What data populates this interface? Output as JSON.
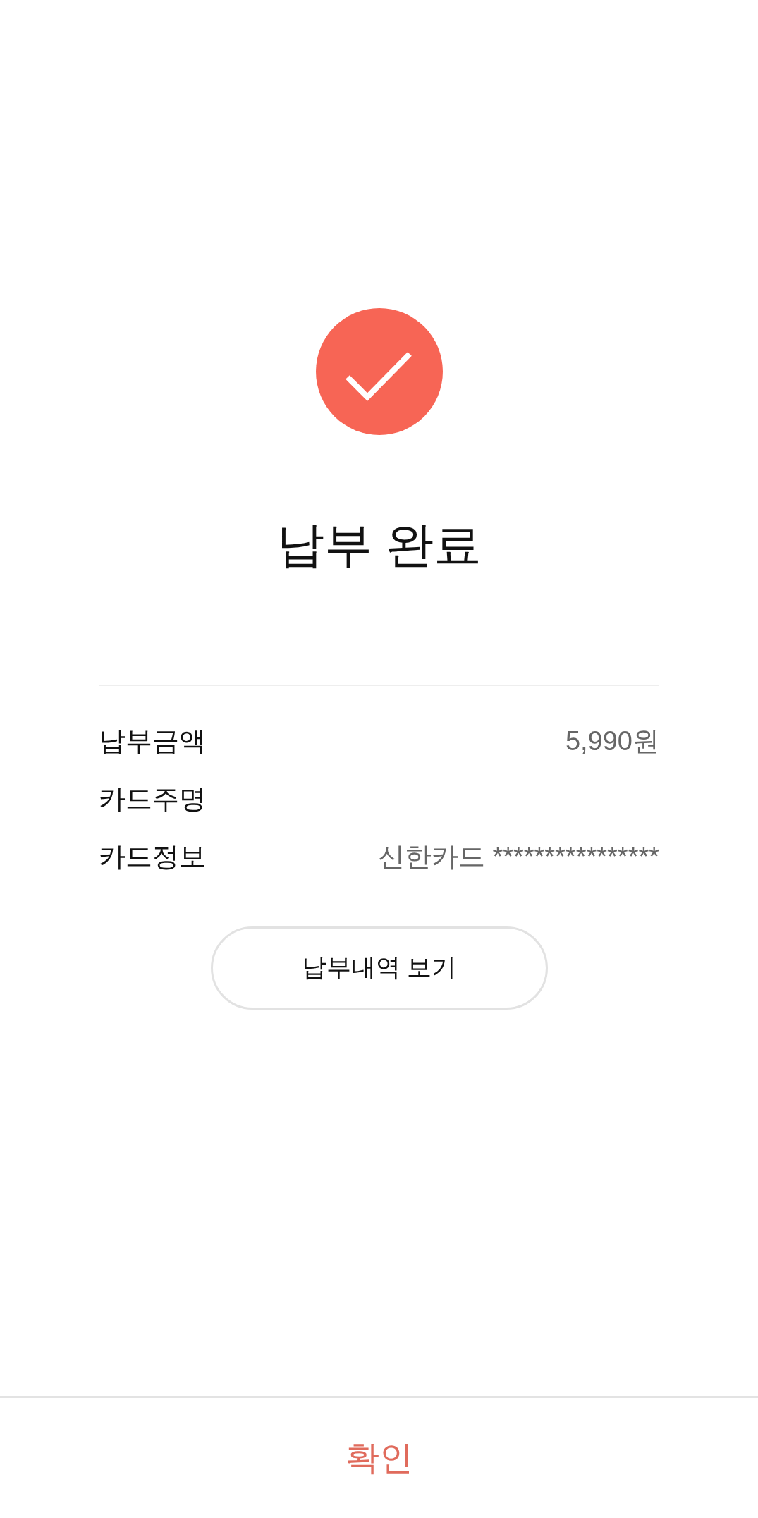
{
  "title": "납부 완료",
  "details": [
    {
      "label": "납부금액",
      "value": "5,990원"
    },
    {
      "label": "카드주명"
    },
    {
      "label": "카드정보",
      "value": "신한카드 ****************"
    }
  ],
  "history_button": {
    "label": "납부내역 보기"
  },
  "confirm_button": {
    "label": "확인"
  }
}
